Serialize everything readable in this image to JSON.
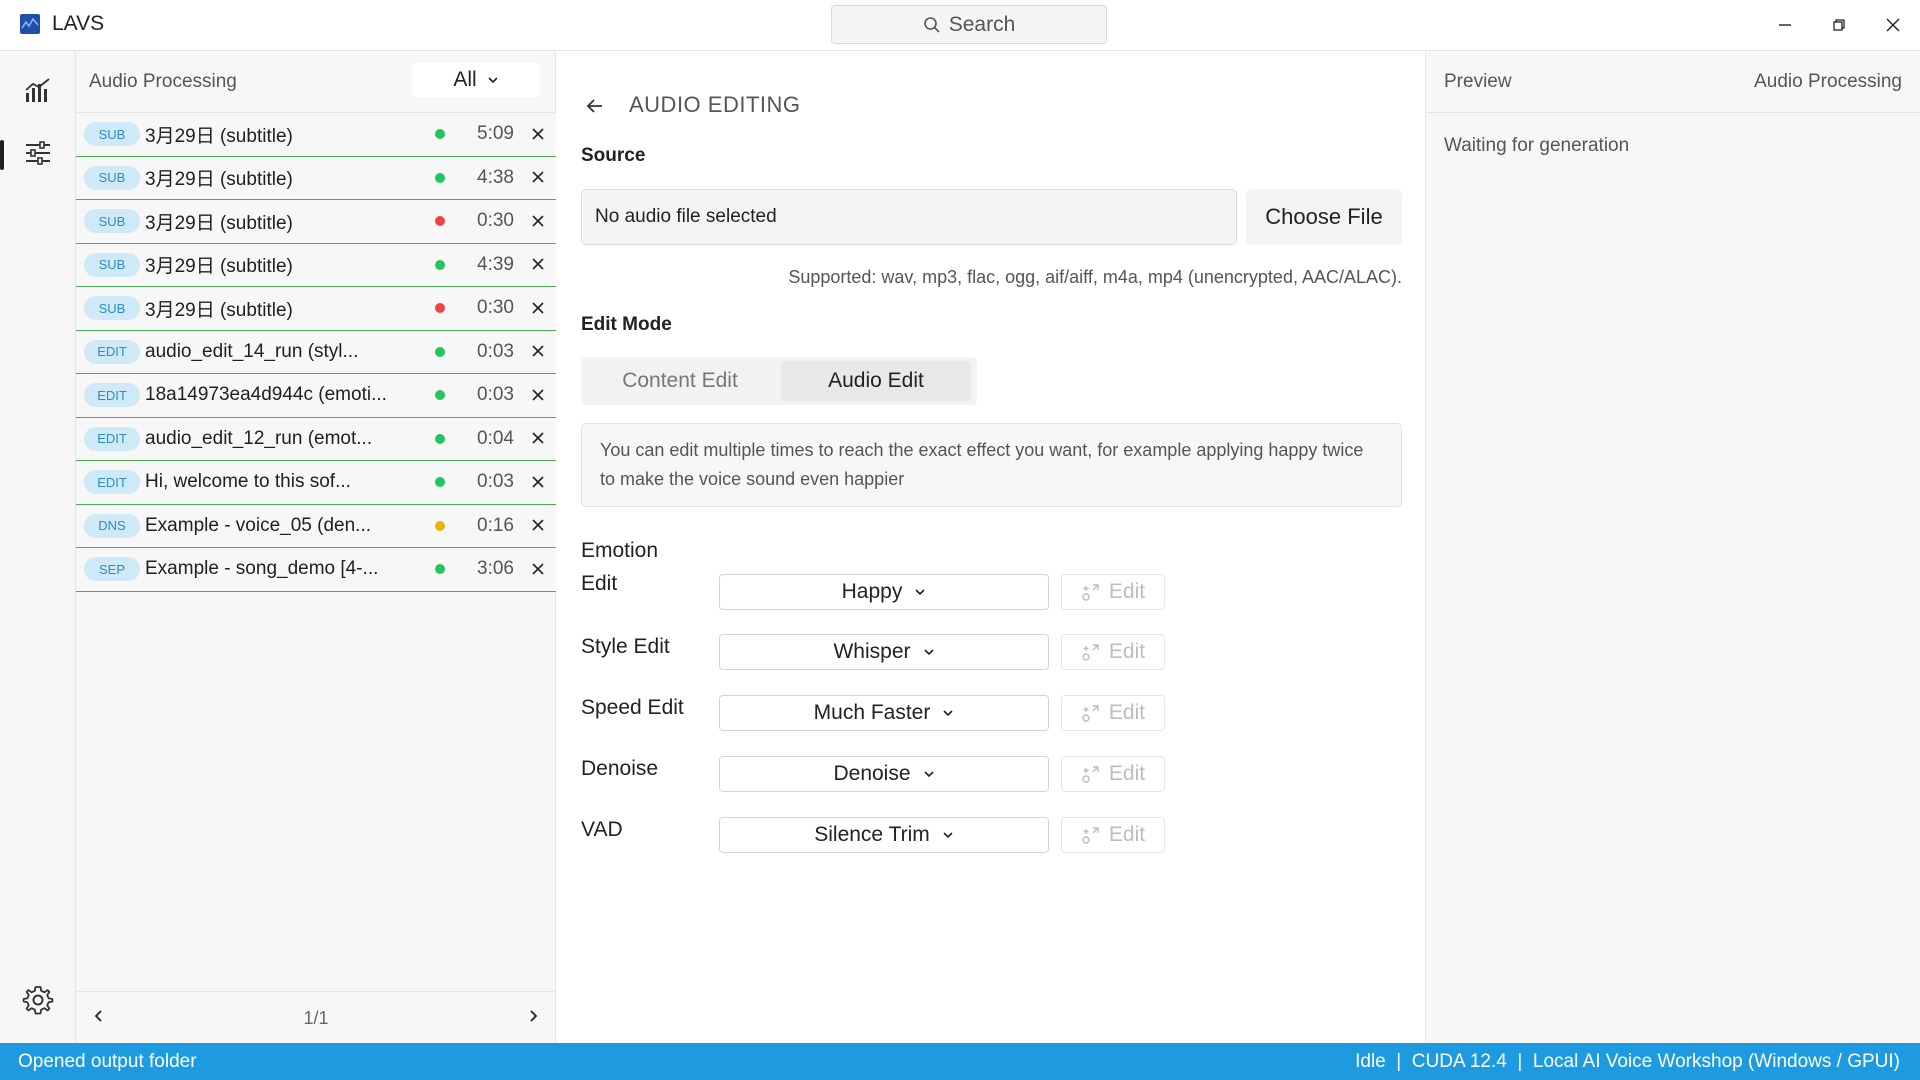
{
  "window": {
    "title": "LAVS",
    "search_label": "Search"
  },
  "tasks": {
    "title": "Audio Processing",
    "filter": "All",
    "items": [
      {
        "badge": "SUB",
        "name": "3月29日 (subtitle)",
        "status": "green",
        "duration": "5:09"
      },
      {
        "badge": "SUB",
        "name": "3月29日 (subtitle)",
        "status": "green",
        "duration": "4:38"
      },
      {
        "badge": "SUB",
        "name": "3月29日 (subtitle)",
        "status": "red",
        "duration": "0:30"
      },
      {
        "badge": "SUB",
        "name": "3月29日 (subtitle)",
        "status": "green",
        "duration": "4:39"
      },
      {
        "badge": "SUB",
        "name": "3月29日 (subtitle)",
        "status": "red",
        "duration": "0:30"
      },
      {
        "badge": "EDIT",
        "name": "audio_edit_14_run (styl...",
        "status": "green",
        "duration": "0:03"
      },
      {
        "badge": "EDIT",
        "name": "18a14973ea4d944c (emoti...",
        "status": "green",
        "duration": "0:03"
      },
      {
        "badge": "EDIT",
        "name": "audio_edit_12_run (emot...",
        "status": "green",
        "duration": "0:04"
      },
      {
        "badge": "EDIT",
        "name": "Hi, welcome to this sof...",
        "status": "green",
        "duration": "0:03"
      },
      {
        "badge": "DNS",
        "name": "Example - voice_05 (den...",
        "status": "amber",
        "duration": "0:16"
      },
      {
        "badge": "SEP",
        "name": "Example - song_demo [4-...",
        "status": "green",
        "duration": "3:06"
      }
    ],
    "pagination": "1/1"
  },
  "editor": {
    "title": "AUDIO EDITING",
    "source_label": "Source",
    "file_placeholder": "No audio file selected",
    "choose_file": "Choose File",
    "supported": "Supported: wav, mp3, flac, ogg, aif/aiff, m4a, mp4 (unencrypted, AAC/ALAC).",
    "edit_mode_label": "Edit Mode",
    "modes": [
      "Content Edit",
      "Audio Edit"
    ],
    "active_mode": "Audio Edit",
    "note": "You can edit multiple times to reach the exact effect you want, for example applying happy twice to make the voice sound even happier",
    "edits": [
      {
        "label_line1": "Emotion",
        "label_line2": "Edit",
        "value": "Happy",
        "button": "Edit"
      },
      {
        "label_line1": "Style Edit",
        "label_line2": "",
        "value": "Whisper",
        "button": "Edit"
      },
      {
        "label_line1": "Speed Edit",
        "label_line2": "",
        "value": "Much Faster",
        "button": "Edit"
      },
      {
        "label_line1": "Denoise",
        "label_line2": "",
        "value": "Denoise",
        "button": "Edit"
      },
      {
        "label_line1": "VAD",
        "label_line2": "",
        "value": "Silence Trim",
        "button": "Edit"
      }
    ]
  },
  "preview": {
    "title": "Preview",
    "section": "Audio Processing",
    "status": "Waiting for generation"
  },
  "statusbar": {
    "left": "Opened output folder",
    "right": "Idle  |  CUDA 12.4  |  Local AI Voice Workshop (Windows / GPUI)"
  },
  "colors": {
    "accent": "#1e9be0",
    "status_green": "#22c55e",
    "status_red": "#ef4444",
    "status_amber": "#eab308",
    "row_border": "#4caf50"
  },
  "icons": [
    "app-logo-icon",
    "search-icon",
    "minimize-icon",
    "restore-icon",
    "close-icon",
    "chart-icon",
    "sliders-icon",
    "gear-icon",
    "chevron-down-icon",
    "arrow-left-icon",
    "chevron-left-icon",
    "chevron-right-icon",
    "x-icon",
    "edit-sparkle-icon"
  ]
}
